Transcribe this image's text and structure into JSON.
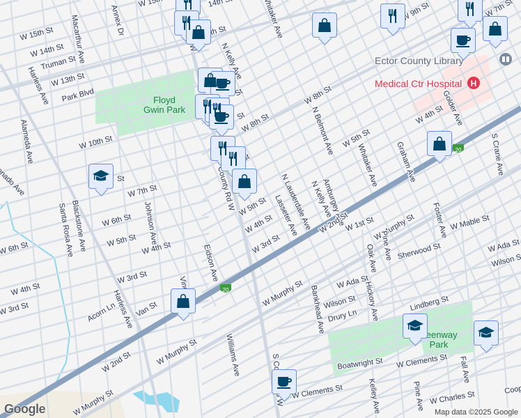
{
  "map": {
    "parks": [
      "Floyd Gwin Park",
      "Greenway Park"
    ],
    "park_label_lines": [
      [
        "Floyd",
        "Gwin Park"
      ],
      [
        "Greenway",
        "Park"
      ]
    ],
    "library": "Ector County Library",
    "hospital": "Medical Ctr Hospital",
    "highway_shield": "20",
    "colors": {
      "background": "#f5f4f5",
      "road": "#d5dde6",
      "highway": "#8aa2be",
      "park": "#c4eed2",
      "hospital": "#fde6e4",
      "water": "#8fd7ec",
      "marker_bg": "#e3ecfd",
      "marker_icon": "#05476b",
      "hospital_red": "#e0364f"
    },
    "street_labels": [
      "W 15th St",
      "14th St",
      "W 15th St",
      "W 14th St",
      "Truman St",
      "W 13th St",
      "Park Blvd",
      "W 10th St",
      "St",
      "W 7th St",
      "W 6th St",
      "W 5th St",
      "W 4th St",
      "W 6th St",
      "W 3rd St",
      "W 4th St",
      "W 3rd St",
      "Acorn Ln",
      "Van St",
      "W 2nd St",
      "W Murphy St",
      "W Murphy St",
      "Harless Ave",
      "Harless Ave",
      "Macarthur Ave",
      "Annex Dr",
      "Alameda Ave",
      "Blackstone Ave",
      "Santa Rosa Ave",
      "Johnson Ave",
      "Eidson Ave",
      "Vine",
      "Williams Ave",
      "onado Ave",
      "County Rd W",
      "Rd W",
      "N Kelly Ave",
      "W 8th St",
      "W 5th St",
      "W 4th St",
      "W 3rd St",
      "Lasseter Ave",
      "N Lauderdale Ave",
      "N Kelly Ave",
      "Amburgey Ave",
      "N Belmont Ave",
      "W 8th St",
      "Whitaker Ave",
      "W 9th St",
      "W 7th St",
      "W 5th St",
      "Whitaker Ave",
      "Graham Ave",
      "W 4th St",
      "Golder Ave",
      "S Crane Ave",
      "W 2nd St",
      "W 1st St",
      "W Murphy St",
      "W Murphy St",
      "Foster Ave",
      "W Mable St",
      "Sherwood St",
      "W Ada St",
      "Wilson St",
      "Oak Ave",
      "Pine Ave",
      "W Ada St",
      "Bankhead Ave",
      "Hickory Ave",
      "Wilson St",
      "Drury Ln",
      "Lindberg St",
      "Boatwright St",
      "W Clements St",
      "W Clements St",
      "S County Rd W",
      "Kelley Ave",
      "Pine Ave",
      "W Charles St",
      "Fall Ave",
      "Coop",
      "th St",
      "St",
      "St",
      "St"
    ],
    "markers": [
      "restaurant",
      "restaurant",
      "shopping",
      "shopping",
      "cafe",
      "restaurant",
      "restaurant",
      "cafe",
      "restaurant",
      "restaurant",
      "shopping",
      "school",
      "shopping",
      "restaurant",
      "restaurant",
      "shopping",
      "cafe",
      "shopping",
      "shopping",
      "cafe",
      "school",
      "school"
    ],
    "logo": "Google",
    "attribution": "Map data ©2025 Google"
  }
}
